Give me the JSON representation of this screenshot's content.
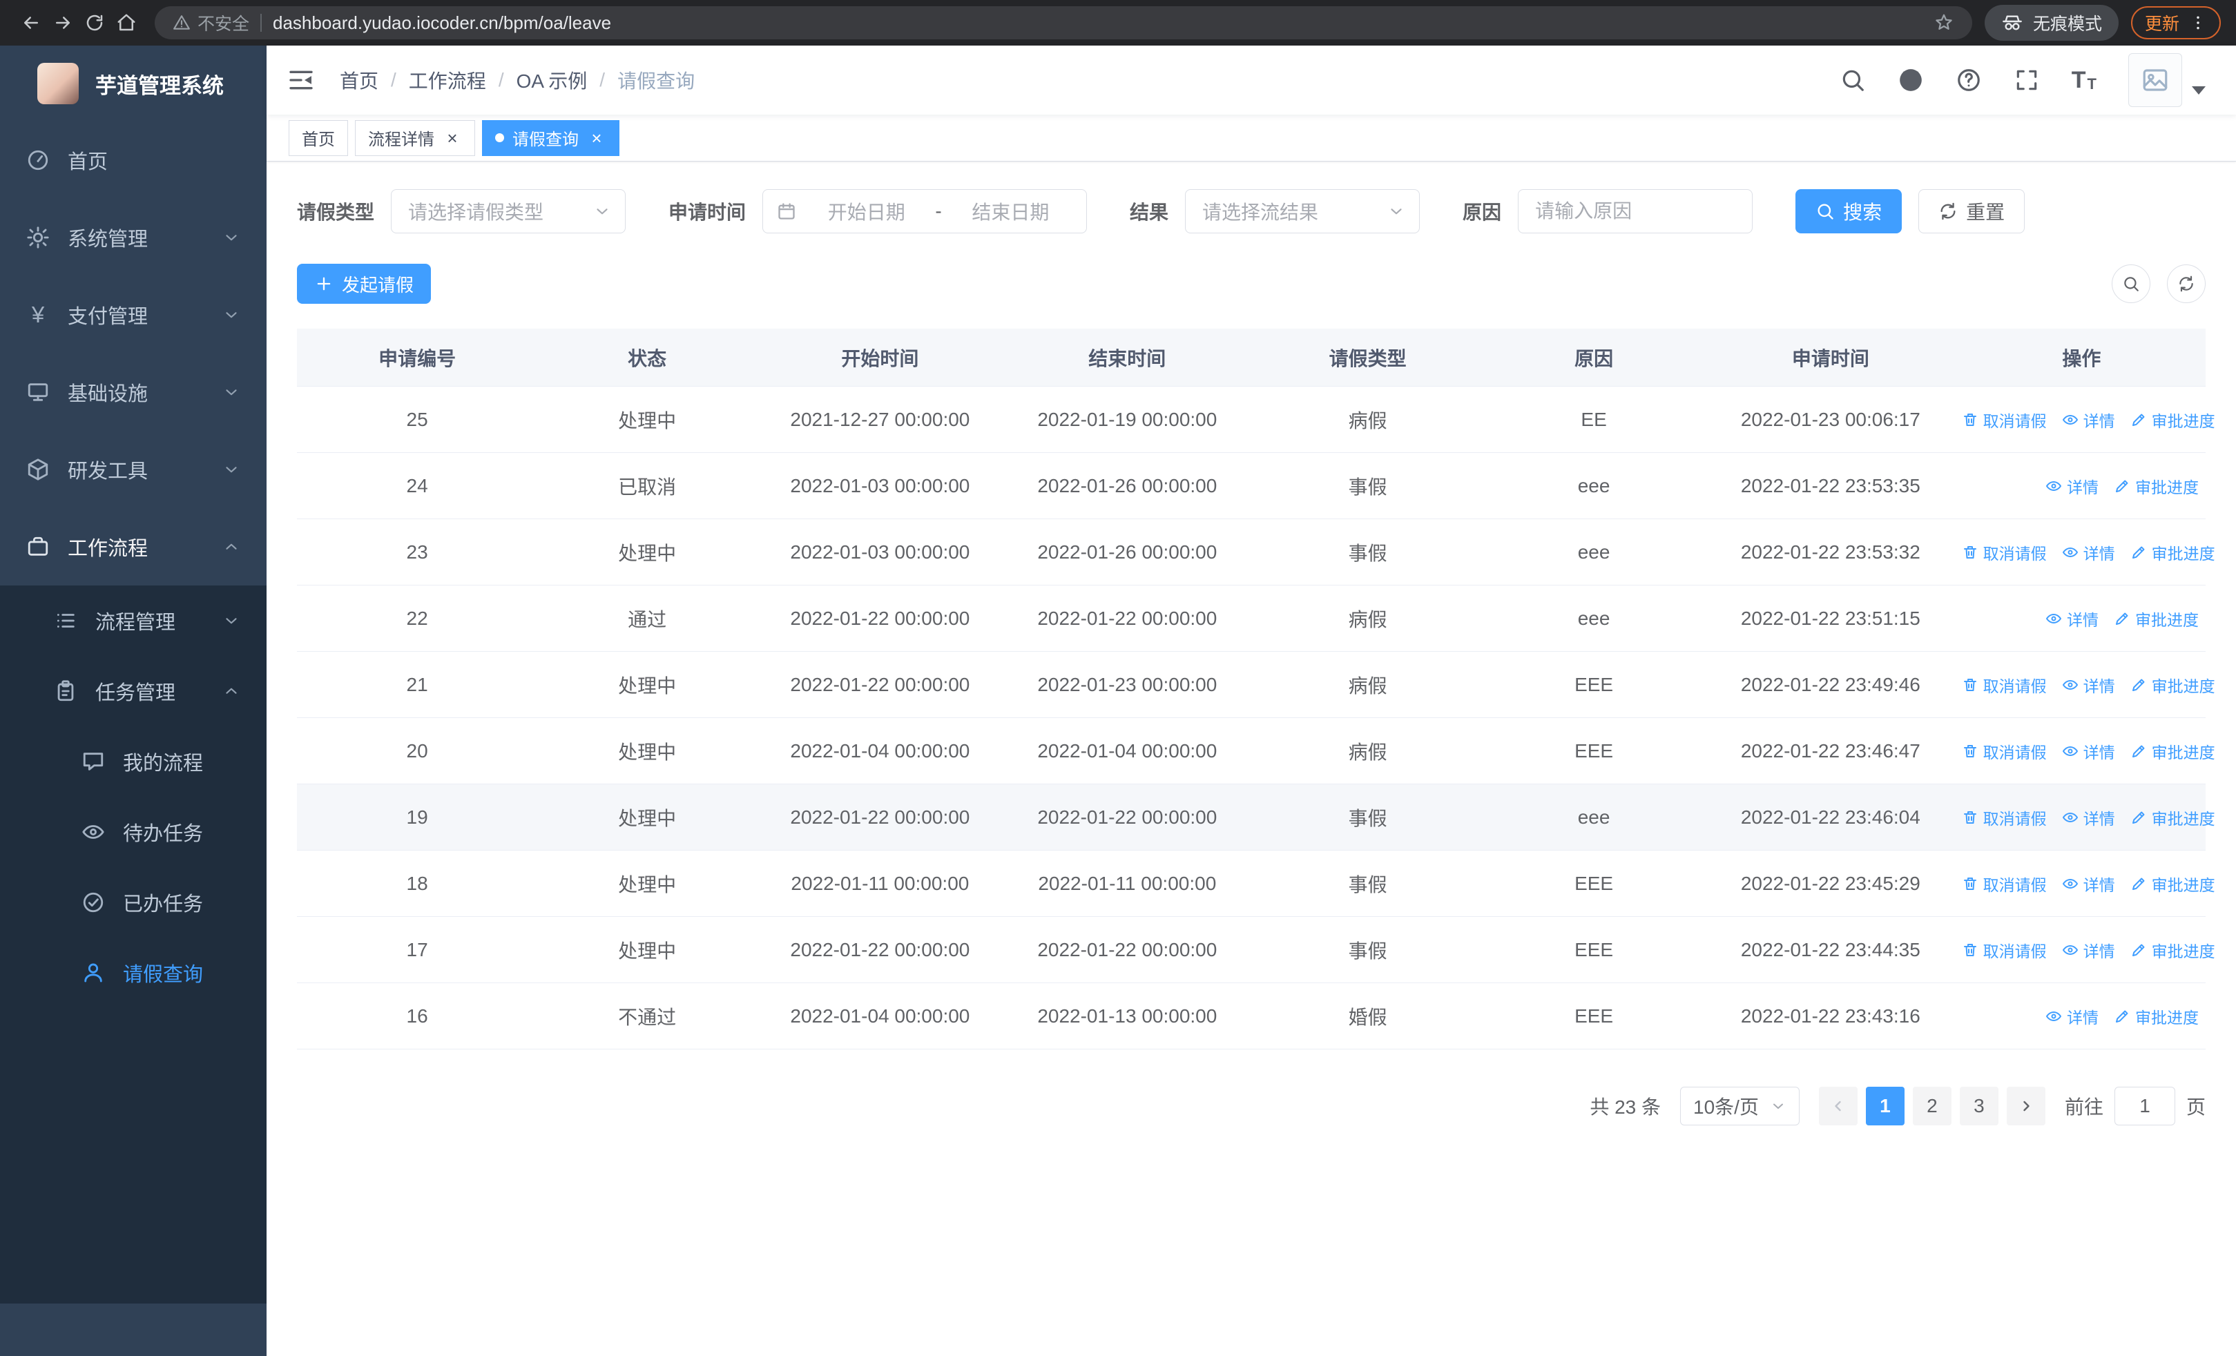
{
  "colors": {
    "primary": "#409eff",
    "sidebar_bg": "#304156",
    "sidebar_submenu_bg": "#1f2d3d",
    "update_accent": "#e8710a"
  },
  "browser": {
    "warning_label": "不安全",
    "url": "dashboard.yudao.iocoder.cn/bpm/oa/leave",
    "incognito_label": "无痕模式",
    "update_label": "更新"
  },
  "sidebar": {
    "title": "芋道管理系统",
    "menu": [
      {
        "label": "首页"
      },
      {
        "label": "系统管理"
      },
      {
        "label": "支付管理"
      },
      {
        "label": "基础设施"
      },
      {
        "label": "研发工具"
      },
      {
        "label": "工作流程"
      },
      {
        "label": "流程管理"
      },
      {
        "label": "任务管理"
      },
      {
        "label": "我的流程"
      },
      {
        "label": "待办任务"
      },
      {
        "label": "已办任务"
      },
      {
        "label": "请假查询"
      }
    ]
  },
  "header": {
    "breadcrumb": [
      "首页",
      "工作流程",
      "OA 示例",
      "请假查询"
    ],
    "separator": "/"
  },
  "tabs": [
    {
      "label": "首页"
    },
    {
      "label": "流程详情"
    },
    {
      "label": "请假查询"
    }
  ],
  "filters": {
    "leave_type_label": "请假类型",
    "leave_type_placeholder": "请选择请假类型",
    "apply_time_label": "申请时间",
    "start_placeholder": "开始日期",
    "range_separator": "-",
    "end_placeholder": "结束日期",
    "result_label": "结果",
    "result_placeholder": "请选择流结果",
    "reason_label": "原因",
    "reason_placeholder": "请输入原因",
    "search_label": "搜索",
    "reset_label": "重置"
  },
  "toolbar": {
    "create_label": "发起请假"
  },
  "table": {
    "columns": [
      "申请编号",
      "状态",
      "开始时间",
      "结束时间",
      "请假类型",
      "原因",
      "申请时间",
      "操作"
    ],
    "op_labels": {
      "cancel": "取消请假",
      "detail": "详情",
      "progress": "审批进度"
    },
    "rows": [
      {
        "id": "25",
        "status": "处理中",
        "start": "2021-12-27 00:00:00",
        "end": "2022-01-19 00:00:00",
        "type": "病假",
        "reason": "EE",
        "applied": "2022-01-23 00:06:17",
        "ops": [
          "cancel",
          "detail",
          "progress"
        ]
      },
      {
        "id": "24",
        "status": "已取消",
        "start": "2022-01-03 00:00:00",
        "end": "2022-01-26 00:00:00",
        "type": "事假",
        "reason": "eee",
        "applied": "2022-01-22 23:53:35",
        "ops": [
          "detail",
          "progress"
        ]
      },
      {
        "id": "23",
        "status": "处理中",
        "start": "2022-01-03 00:00:00",
        "end": "2022-01-26 00:00:00",
        "type": "事假",
        "reason": "eee",
        "applied": "2022-01-22 23:53:32",
        "ops": [
          "cancel",
          "detail",
          "progress"
        ]
      },
      {
        "id": "22",
        "status": "通过",
        "start": "2022-01-22 00:00:00",
        "end": "2022-01-22 00:00:00",
        "type": "病假",
        "reason": "eee",
        "applied": "2022-01-22 23:51:15",
        "ops": [
          "detail",
          "progress"
        ]
      },
      {
        "id": "21",
        "status": "处理中",
        "start": "2022-01-22 00:00:00",
        "end": "2022-01-23 00:00:00",
        "type": "病假",
        "reason": "EEE",
        "applied": "2022-01-22 23:49:46",
        "ops": [
          "cancel",
          "detail",
          "progress"
        ]
      },
      {
        "id": "20",
        "status": "处理中",
        "start": "2022-01-04 00:00:00",
        "end": "2022-01-04 00:00:00",
        "type": "病假",
        "reason": "EEE",
        "applied": "2022-01-22 23:46:47",
        "ops": [
          "cancel",
          "detail",
          "progress"
        ]
      },
      {
        "id": "19",
        "status": "处理中",
        "start": "2022-01-22 00:00:00",
        "end": "2022-01-22 00:00:00",
        "type": "事假",
        "reason": "eee",
        "applied": "2022-01-22 23:46:04",
        "ops": [
          "cancel",
          "detail",
          "progress"
        ],
        "highlighted": true
      },
      {
        "id": "18",
        "status": "处理中",
        "start": "2022-01-11 00:00:00",
        "end": "2022-01-11 00:00:00",
        "type": "事假",
        "reason": "EEE",
        "applied": "2022-01-22 23:45:29",
        "ops": [
          "cancel",
          "detail",
          "progress"
        ]
      },
      {
        "id": "17",
        "status": "处理中",
        "start": "2022-01-22 00:00:00",
        "end": "2022-01-22 00:00:00",
        "type": "事假",
        "reason": "EEE",
        "applied": "2022-01-22 23:44:35",
        "ops": [
          "cancel",
          "detail",
          "progress"
        ]
      },
      {
        "id": "16",
        "status": "不通过",
        "start": "2022-01-04 00:00:00",
        "end": "2022-01-13 00:00:00",
        "type": "婚假",
        "reason": "EEE",
        "applied": "2022-01-22 23:43:16",
        "ops": [
          "detail",
          "progress"
        ]
      }
    ]
  },
  "pagination": {
    "total_text": "共 23 条",
    "page_size": "10条/页",
    "pages": [
      "1",
      "2",
      "3"
    ],
    "active_page": "1",
    "goto_label": "前往",
    "goto_value": "1",
    "unit_label": "页"
  }
}
